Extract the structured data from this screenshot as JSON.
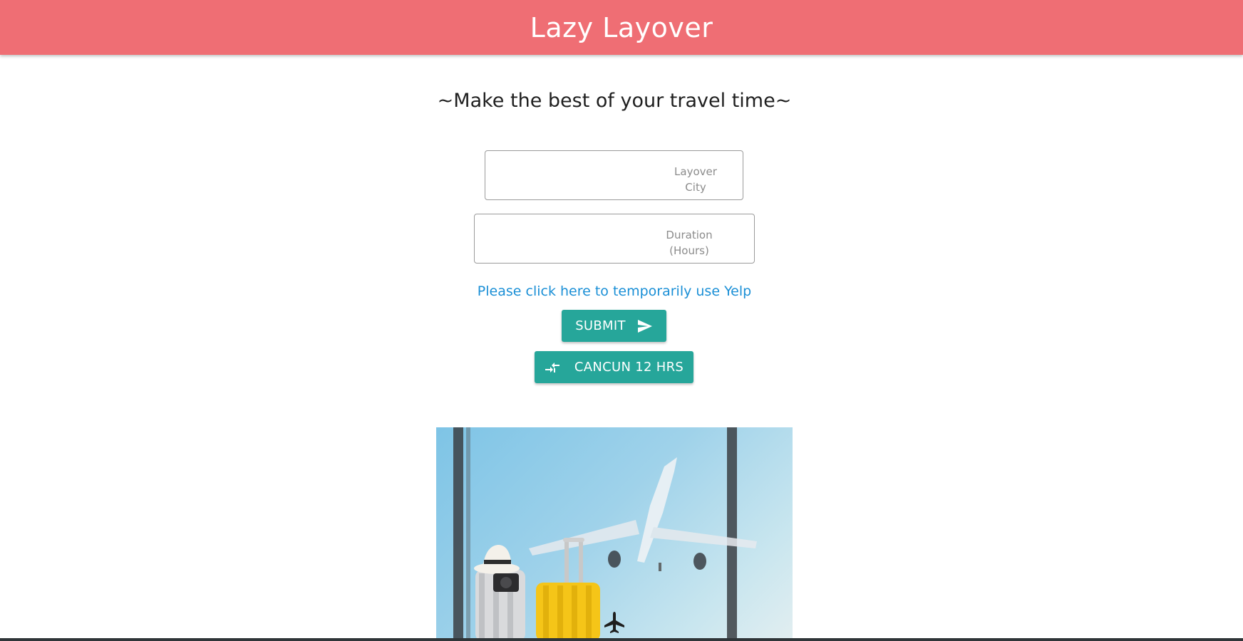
{
  "header": {
    "title": "Lazy Layover"
  },
  "main": {
    "tagline": "~Make the best of your travel time~",
    "fields": {
      "city_label": "Layover City",
      "duration_label": "Duration (Hours)"
    },
    "yelp_link": "Please click here to temporarily use Yelp",
    "submit_button": {
      "label": "SUBMIT",
      "icon": "send-icon"
    },
    "preset_button": {
      "label": "CANCUN 12 HRS",
      "icon": "compare-arrows-icon"
    },
    "hero_image": {
      "description_icon": "airplane-icon"
    }
  },
  "colors": {
    "header_bg": "#ef6e74",
    "button_bg": "#26a69a",
    "link": "#1a8fd6"
  }
}
